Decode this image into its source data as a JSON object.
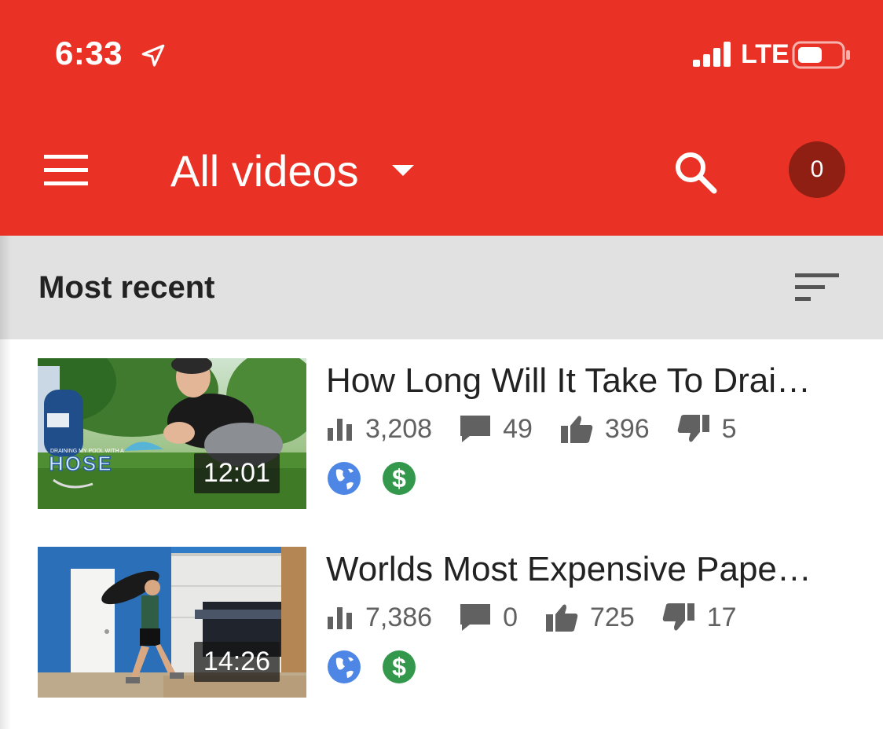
{
  "status_bar": {
    "time": "6:33",
    "network": "LTE",
    "icons": [
      "location-arrow-icon",
      "signal-bars-icon",
      "battery-icon"
    ]
  },
  "app_bar": {
    "title": "All videos",
    "notification_count": "0",
    "icons": [
      "menu-icon",
      "dropdown-caret-icon",
      "search-icon"
    ],
    "color": "#e93225"
  },
  "sort_bar": {
    "label": "Most recent",
    "icon": "sort-icon"
  },
  "videos": [
    {
      "title": "How Long Will It Take To Drai…",
      "duration": "12:01",
      "views": "3,208",
      "comments": "49",
      "likes": "396",
      "dislikes": "5",
      "thumb_text_top": "DRAINING MY POOL WITH A",
      "thumb_text_main": "HOSE",
      "visibility_icon": "globe-icon",
      "monetization_icon": "dollar-icon",
      "monetization_symbol": "$"
    },
    {
      "title": "Worlds Most Expensive Pape…",
      "duration": "14:26",
      "views": "7,386",
      "comments": "0",
      "likes": "725",
      "dislikes": "17",
      "visibility_icon": "globe-icon",
      "monetization_icon": "dollar-icon",
      "monetization_symbol": "$"
    }
  ],
  "colors": {
    "public_badge": "#4e86e6",
    "monetized_badge": "#33984c",
    "notification_bg": "#8e1f12"
  }
}
